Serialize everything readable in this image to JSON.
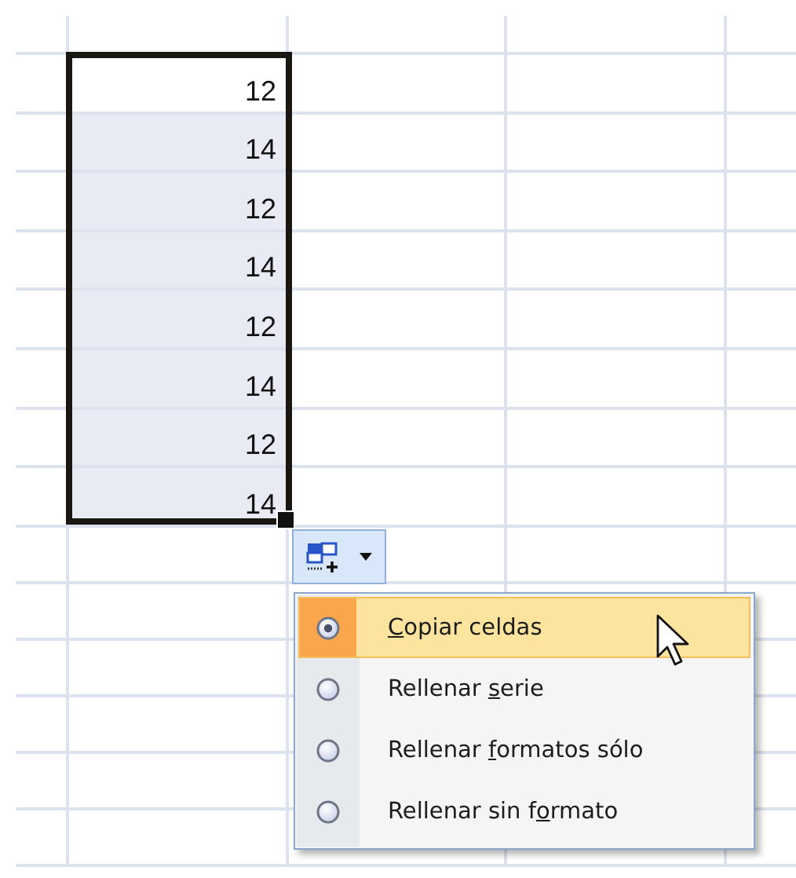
{
  "sheet": {
    "column_b": [
      "12",
      "14",
      "12",
      "14",
      "12",
      "14",
      "12",
      "14"
    ]
  },
  "autofill_button": {
    "expanded": true
  },
  "menu": {
    "items": [
      {
        "label": {
          "access_key": "C",
          "after": "opiar celdas"
        },
        "selected": true,
        "hovered": true
      },
      {
        "label": {
          "before": "Rellenar ",
          "access_key": "s",
          "after": "erie"
        },
        "selected": false,
        "hovered": false
      },
      {
        "label": {
          "before": "Rellenar ",
          "access_key": "f",
          "after": "ormatos sólo"
        },
        "selected": false,
        "hovered": false
      },
      {
        "label": {
          "before": "Rellenar sin f",
          "access_key": "o",
          "after": "rmato"
        },
        "selected": false,
        "hovered": false
      }
    ]
  }
}
